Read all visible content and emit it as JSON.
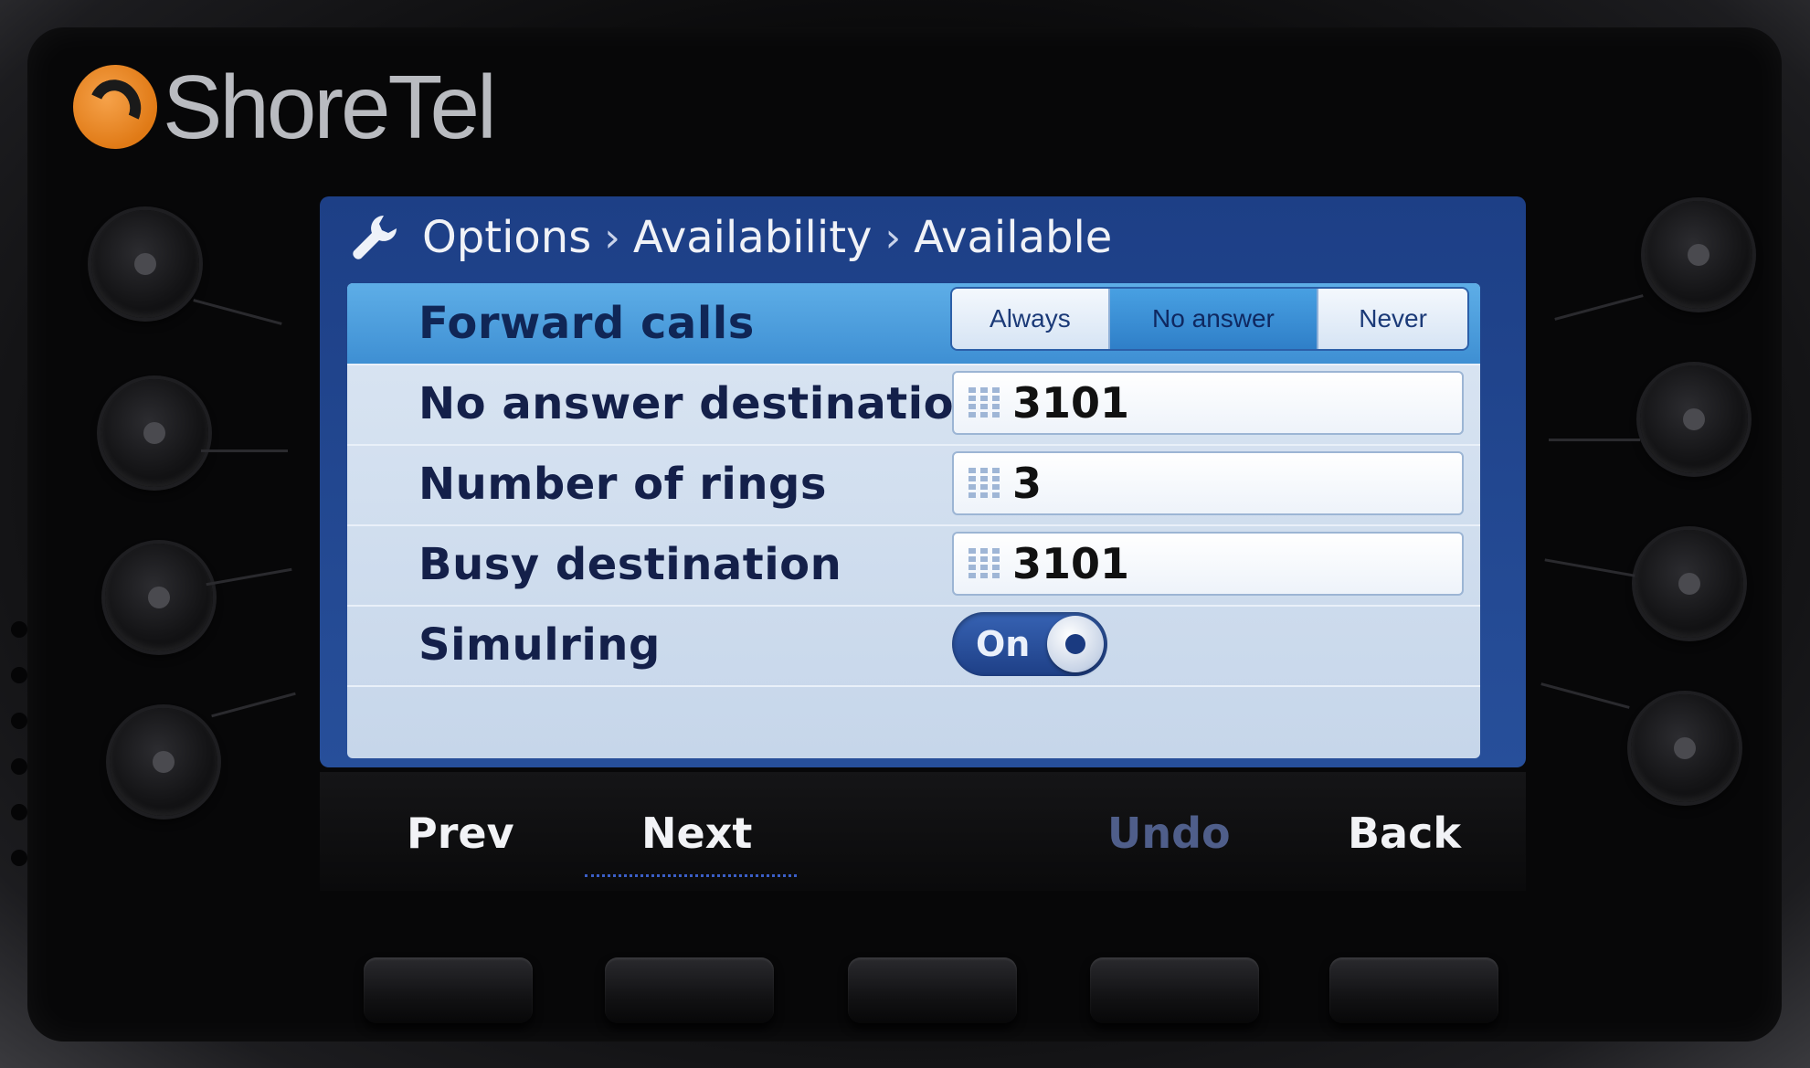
{
  "brand": {
    "name": "ShoreTel",
    "logo_icon": "shoretel-swirl-logo",
    "accent": "#e8861f"
  },
  "breadcrumb": {
    "items": [
      "Options",
      "Availability",
      "Available"
    ],
    "separator": "›",
    "icon": "wrench-icon"
  },
  "rows": {
    "forward_calls": {
      "label": "Forward calls",
      "options": [
        "Always",
        "No answer",
        "Never"
      ],
      "selected": "No answer"
    },
    "no_answer_destination": {
      "label": "No answer destination",
      "value": "3101"
    },
    "number_of_rings": {
      "label": "Number of rings",
      "value": "3"
    },
    "busy_destination": {
      "label": "Busy destination",
      "value": "3101"
    },
    "simulring": {
      "label": "Simulring",
      "value": "On"
    }
  },
  "softkeys": [
    {
      "label": "Prev",
      "enabled": true
    },
    {
      "label": "Next",
      "enabled": true,
      "focused": true
    },
    {
      "label": "Undo",
      "enabled": false
    },
    {
      "label": "Back",
      "enabled": true
    }
  ],
  "colors": {
    "screen_bg": "#1d3f86",
    "selected_row": "#4a9de0",
    "panel_bg": "#d3e0f0"
  }
}
